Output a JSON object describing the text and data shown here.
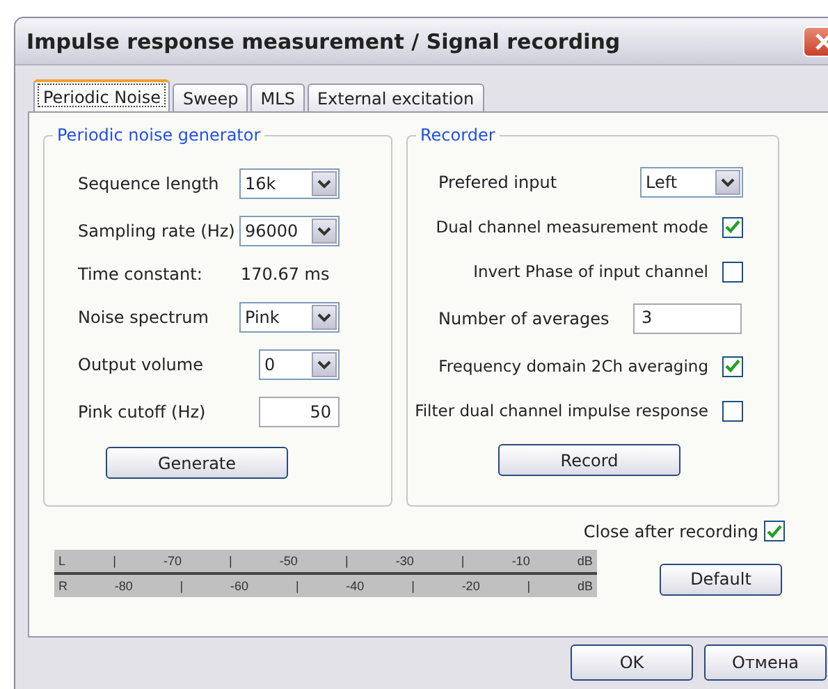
{
  "window": {
    "title": "Impulse response measurement / Signal recording"
  },
  "tabs": [
    {
      "label": "Periodic Noise",
      "selected": true
    },
    {
      "label": "Sweep",
      "selected": false
    },
    {
      "label": "MLS",
      "selected": false
    },
    {
      "label": "External excitation",
      "selected": false
    }
  ],
  "generator": {
    "title": "Periodic noise generator",
    "rows": [
      {
        "kind": "combo",
        "label": "Sequence length",
        "value": "16k"
      },
      {
        "kind": "combo",
        "label": "Sampling rate (Hz)",
        "value": "96000"
      },
      {
        "kind": "readout",
        "label": "Time constant:",
        "value": "170.67 ms"
      },
      {
        "kind": "combo",
        "label": "Noise spectrum",
        "value": "Pink"
      },
      {
        "kind": "combo-narrow",
        "label": "Output volume",
        "value": "0"
      },
      {
        "kind": "input",
        "label": "Pink cutoff (Hz)",
        "value": "50"
      }
    ],
    "button": "Generate"
  },
  "recorder": {
    "title": "Recorder",
    "rows": [
      {
        "kind": "combo",
        "label": "Prefered input",
        "value": "Left"
      },
      {
        "kind": "checkbox",
        "label": "Dual channel measurement mode",
        "checked": true
      },
      {
        "kind": "checkbox",
        "label": "Invert Phase of input channel",
        "checked": false
      },
      {
        "kind": "input",
        "label": "Number of averages",
        "value": "3"
      },
      {
        "kind": "checkbox",
        "label": "Frequency domain 2Ch averaging",
        "checked": true
      },
      {
        "kind": "checkbox",
        "label": "Filter dual channel impulse response",
        "checked": false
      }
    ],
    "button": "Record"
  },
  "close_after_recording": {
    "label": "Close after recording",
    "checked": true
  },
  "meter": {
    "rows": [
      {
        "cells": [
          "L",
          "|",
          "-70",
          "|",
          "-50",
          "|",
          "-30",
          "|",
          "-10",
          "dB"
        ]
      },
      {
        "cells": [
          "R",
          "-80",
          "|",
          "-60",
          "|",
          "-40",
          "|",
          "-20",
          "|",
          "dB"
        ]
      }
    ]
  },
  "default_button": "Default",
  "buttons": [
    "OK",
    "Отмена"
  ]
}
